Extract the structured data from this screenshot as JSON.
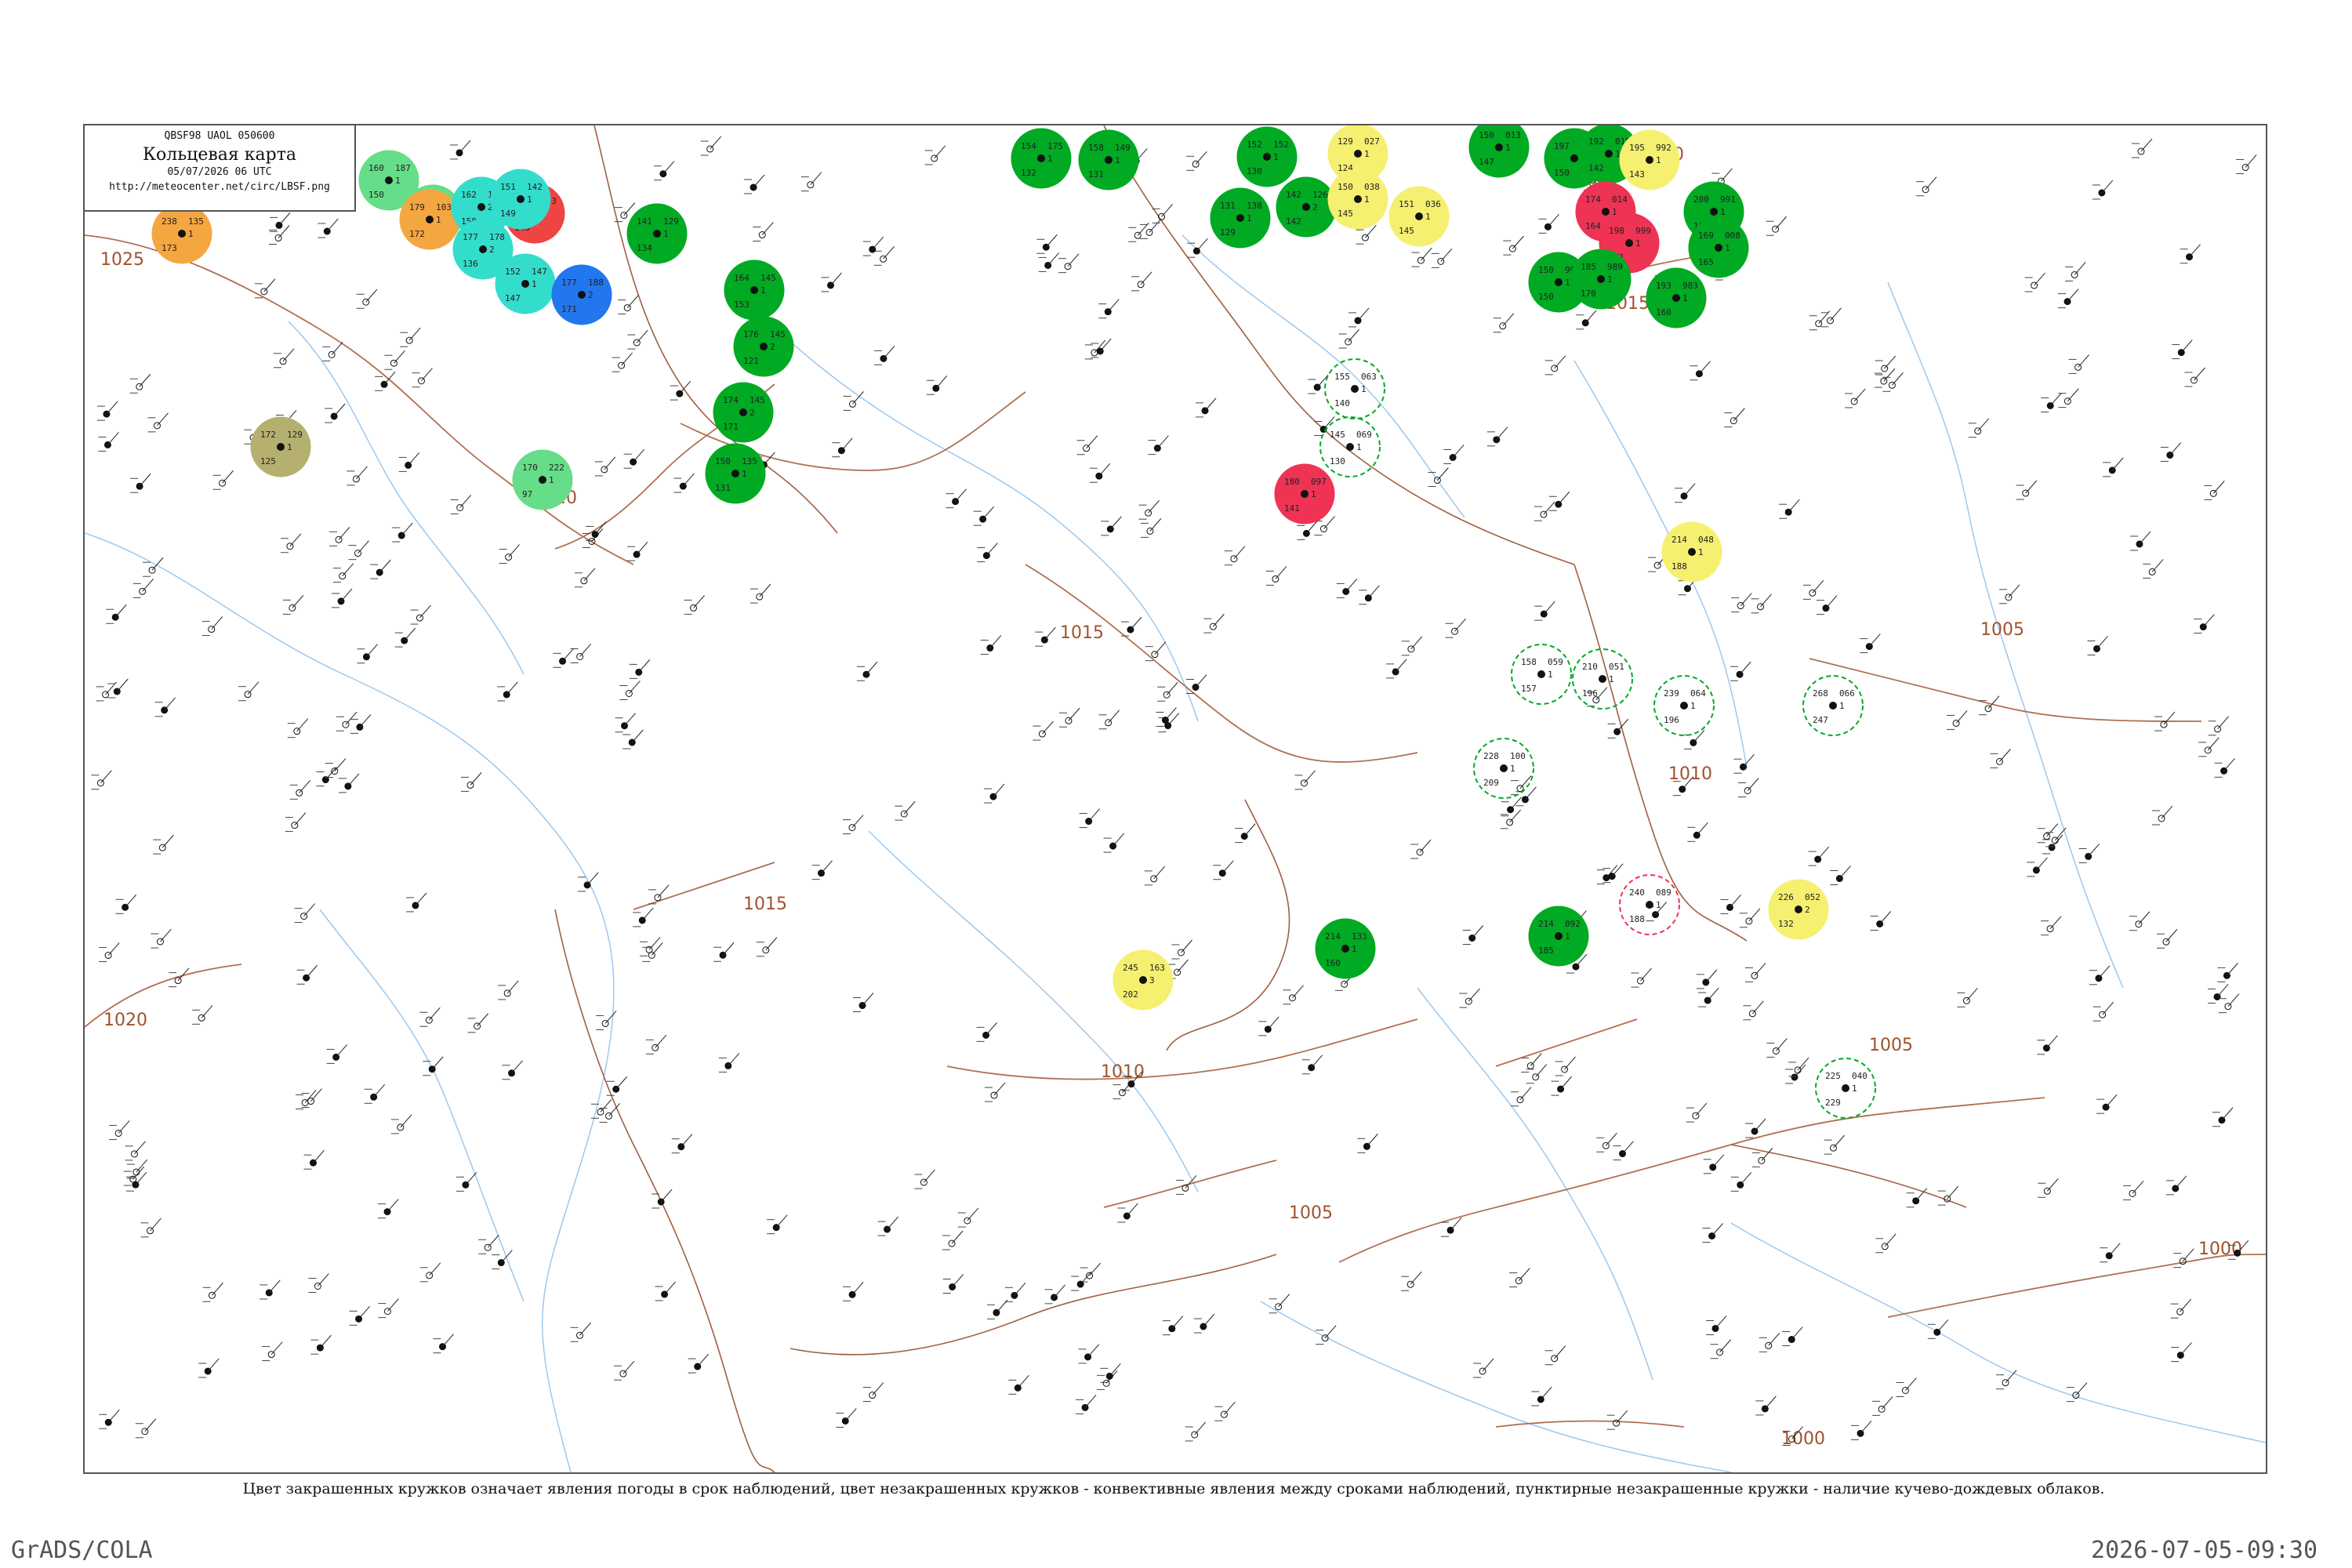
{
  "header": {
    "bulletin_code": "QBSF98  UAOL  050600",
    "title": "Кольцевая карта",
    "datetime": "05/07/2026 06 UTC",
    "url": "http://meteocenter.net/circ/LBSF.png"
  },
  "caption": "Цвет закрашенных кружков означает явления погоды в срок наблюдений, цвет незакрашенных кружков - конвективные явления между сроками наблюдений, пунктирные незакрашенные кружки - наличие кучево-дождевых облаков.",
  "footer": {
    "credit": "GrADS/COLA",
    "timestamp": "2026-07-05-09:30"
  },
  "isobars": [
    {
      "label": "1025"
    },
    {
      "label": "1020"
    },
    {
      "label": "1020"
    },
    {
      "label": "1015"
    },
    {
      "label": "1015"
    },
    {
      "label": "1015"
    },
    {
      "label": "1010"
    },
    {
      "label": "1010"
    },
    {
      "label": "1005"
    },
    {
      "label": "1005"
    },
    {
      "label": "1005"
    },
    {
      "label": "1000"
    },
    {
      "label": "1000"
    },
    {
      "label": "1000"
    }
  ],
  "stations": [
    {
      "t": "238",
      "p": "135",
      "d": "173",
      "s": "1",
      "c": "#f4a640",
      "fill": true
    },
    {
      "t": "160",
      "p": "187",
      "d": "150",
      "s": "1",
      "c": "#66dd88",
      "fill": true
    },
    {
      "t": "185",
      "p": "132",
      "d": "177",
      "s": "2",
      "c": "#66dd88",
      "fill": true
    },
    {
      "t": "179",
      "p": "103",
      "d": "172",
      "s": "1",
      "c": "#f4a640",
      "fill": true
    },
    {
      "t": "162",
      "p": "143",
      "d": "158",
      "s": "2",
      "c": "#33ddcc",
      "fill": true
    },
    {
      "t": "159",
      "p": "153",
      "d": "148",
      "s": "2",
      "c": "#ee4444",
      "fill": true
    },
    {
      "t": "151",
      "p": "142",
      "d": "149",
      "s": "1",
      "c": "#33ddcc",
      "fill": true
    },
    {
      "t": "177",
      "p": "178",
      "d": "136",
      "s": "2",
      "c": "#33ddcc",
      "fill": true
    },
    {
      "t": "152",
      "p": "147",
      "d": "147",
      "s": "1",
      "c": "#33ddcc",
      "fill": true
    },
    {
      "t": "177",
      "p": "188",
      "d": "171",
      "s": "2",
      "c": "#2277ee",
      "fill": true
    },
    {
      "t": "141",
      "p": "129",
      "d": "134",
      "s": "1",
      "c": "#00aa22",
      "fill": true
    },
    {
      "t": "164",
      "p": "145",
      "d": "153",
      "s": "1",
      "c": "#00aa22",
      "fill": true
    },
    {
      "t": "176",
      "p": "145",
      "d": "121",
      "s": "2",
      "c": "#00aa22",
      "fill": true
    },
    {
      "t": "174",
      "p": "145",
      "d": "171",
      "s": "2",
      "c": "#00aa22",
      "fill": true
    },
    {
      "t": "170",
      "p": "222",
      "d": "97",
      "s": "1",
      "c": "#66dd88",
      "fill": true
    },
    {
      "t": "172",
      "p": "129",
      "d": "125",
      "s": "1",
      "c": "#b5b070",
      "fill": true
    },
    {
      "t": "150",
      "p": "135",
      "d": "131",
      "s": "1",
      "c": "#00aa22",
      "fill": true
    },
    {
      "t": "154",
      "p": "175",
      "d": "132",
      "s": "1",
      "c": "#00aa22",
      "fill": true
    },
    {
      "t": "158",
      "p": "149",
      "d": "131",
      "s": "1",
      "c": "#00aa22",
      "fill": true
    },
    {
      "t": "152",
      "p": "152",
      "d": "130",
      "s": "1",
      "c": "#00aa22",
      "fill": true
    },
    {
      "t": "131",
      "p": "138",
      "d": "129",
      "s": "1",
      "c": "#00aa22",
      "fill": true
    },
    {
      "t": "142",
      "p": "126",
      "d": "142",
      "s": "2",
      "c": "#00aa22",
      "fill": true
    },
    {
      "t": "129",
      "p": "027",
      "d": "124",
      "s": "1",
      "c": "#f5f070",
      "fill": true
    },
    {
      "t": "150",
      "p": "038",
      "d": "145",
      "s": "1",
      "c": "#f5f070",
      "fill": true
    },
    {
      "t": "151",
      "p": "036",
      "d": "145",
      "s": "1",
      "c": "#f5f070",
      "fill": true
    },
    {
      "t": "150",
      "p": "013",
      "d": "147",
      "s": "1",
      "c": "#00aa22",
      "fill": true
    },
    {
      "t": "197",
      "p": "031",
      "d": "150",
      "s": "1",
      "c": "#00aa22",
      "fill": true
    },
    {
      "t": "192",
      "p": "015",
      "d": "142",
      "s": "1",
      "c": "#00aa22",
      "fill": true
    },
    {
      "t": "195",
      "p": "992",
      "d": "143",
      "s": "1",
      "c": "#f5f070",
      "fill": true
    },
    {
      "t": "174",
      "p": "014",
      "d": "164",
      "s": "1",
      "c": "#ee3355",
      "fill": true
    },
    {
      "t": "198",
      "p": "999",
      "d": "171",
      "s": "1",
      "c": "#ee3355",
      "fill": true
    },
    {
      "t": "200",
      "p": "991",
      "d": "166",
      "s": "1",
      "c": "#00aa22",
      "fill": true
    },
    {
      "t": "169",
      "p": "008",
      "d": "165",
      "s": "1",
      "c": "#00aa22",
      "fill": true
    },
    {
      "t": "150",
      "p": "996",
      "d": "150",
      "s": "1",
      "c": "#00aa22",
      "fill": true
    },
    {
      "t": "185",
      "p": "989",
      "d": "170",
      "s": "1",
      "c": "#00aa22",
      "fill": true
    },
    {
      "t": "193",
      "p": "983",
      "d": "160",
      "s": "1",
      "c": "#00aa22",
      "fill": true
    },
    {
      "t": "180",
      "p": "097",
      "d": "141",
      "s": "1",
      "c": "#ee3355",
      "fill": true
    },
    {
      "t": "214",
      "p": "048",
      "d": "188",
      "s": "1",
      "c": "#f5f070",
      "fill": true
    },
    {
      "t": "214",
      "p": "092",
      "d": "185",
      "s": "1",
      "c": "#00aa22",
      "fill": true
    },
    {
      "t": "226",
      "p": "052",
      "d": "132",
      "s": "2",
      "c": "#f5f070",
      "fill": true
    },
    {
      "t": "245",
      "p": "163",
      "d": "202",
      "s": "3",
      "c": "#f5f070",
      "fill": true
    },
    {
      "t": "214",
      "p": "133",
      "d": "160",
      "s": "1",
      "c": "#00aa22",
      "fill": true
    },
    {
      "t": "158",
      "p": "059",
      "d": "157",
      "s": "1",
      "c": "#00aa22",
      "fill": false
    },
    {
      "t": "210",
      "p": "051",
      "d": "196",
      "s": "1",
      "c": "#00aa22",
      "fill": false
    },
    {
      "t": "239",
      "p": "064",
      "d": "196",
      "s": "1",
      "c": "#00aa22",
      "fill": false
    },
    {
      "t": "228",
      "p": "100",
      "d": "209",
      "s": "1",
      "c": "#00aa22",
      "fill": false
    },
    {
      "t": "240",
      "p": "089",
      "d": "188",
      "s": "1",
      "c": "#ee3355",
      "fill": false
    },
    {
      "t": "155",
      "p": "063",
      "d": "140",
      "s": "1",
      "c": "#00aa22",
      "fill": false
    },
    {
      "t": "145",
      "p": "069",
      "d": "130",
      "s": "1",
      "c": "#00aa22",
      "fill": false
    },
    {
      "t": "268",
      "p": "066",
      "d": "247",
      "s": "1",
      "c": "#00aa22",
      "fill": false
    },
    {
      "t": "225",
      "p": "040",
      "d": "229",
      "s": "1",
      "c": "#00aa22",
      "fill": false
    }
  ]
}
